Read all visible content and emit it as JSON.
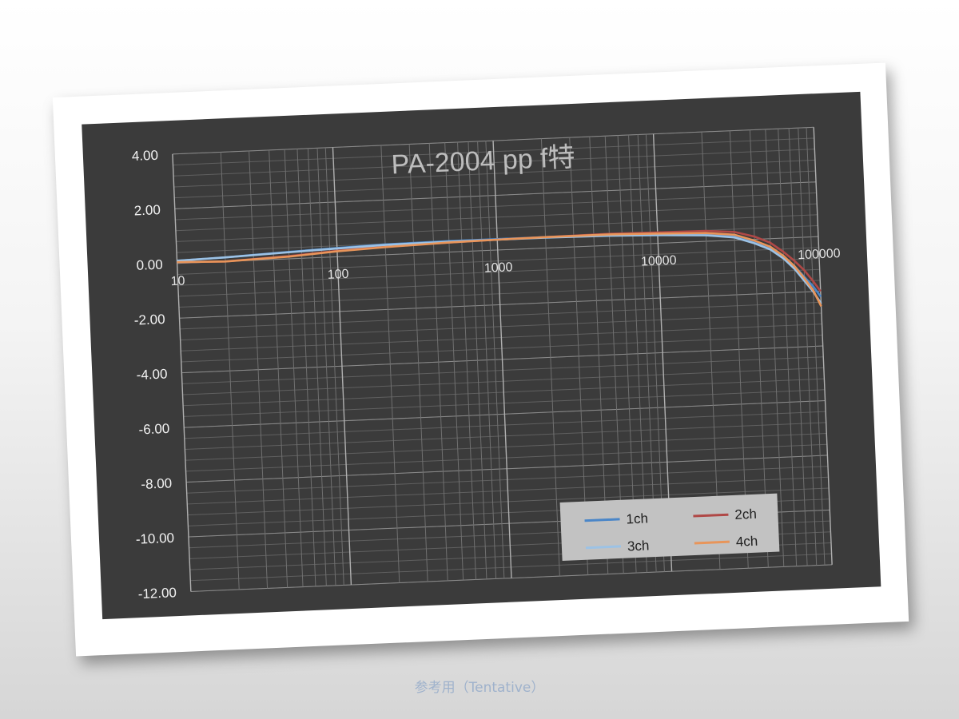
{
  "chart_data": {
    "type": "line",
    "title": "PA-2004 pp f特",
    "xscale": "log",
    "xlim": [
      10,
      100000
    ],
    "ylim": [
      -12,
      4
    ],
    "x_ticks": [
      "10",
      "100",
      "1000",
      "10000",
      "100000"
    ],
    "y_ticks": [
      "4.00",
      "2.00",
      "0.00",
      "-2.00",
      "-4.00",
      "-6.00",
      "-8.00",
      "-10.00",
      "-12.00"
    ],
    "grid": true,
    "legend_position": "bottom-right",
    "series": [
      {
        "name": "1ch",
        "color": "#4a86c8",
        "points": [
          [
            10,
            0.1
          ],
          [
            20,
            0.15
          ],
          [
            50,
            0.25
          ],
          [
            100,
            0.32
          ],
          [
            200,
            0.38
          ],
          [
            500,
            0.4
          ],
          [
            1000,
            0.4
          ],
          [
            2000,
            0.4
          ],
          [
            5000,
            0.38
          ],
          [
            10000,
            0.3
          ],
          [
            20000,
            0.25
          ],
          [
            30000,
            0.15
          ],
          [
            40000,
            -0.1
          ],
          [
            50000,
            -0.35
          ],
          [
            60000,
            -0.7
          ],
          [
            70000,
            -1.05
          ],
          [
            80000,
            -1.45
          ],
          [
            90000,
            -1.8
          ],
          [
            100000,
            -2.2
          ]
        ]
      },
      {
        "name": "2ch",
        "color": "#b04846",
        "points": [
          [
            10,
            0.05
          ],
          [
            20,
            0.0
          ],
          [
            50,
            0.1
          ],
          [
            100,
            0.22
          ],
          [
            200,
            0.3
          ],
          [
            500,
            0.35
          ],
          [
            1000,
            0.38
          ],
          [
            2000,
            0.4
          ],
          [
            5000,
            0.42
          ],
          [
            10000,
            0.4
          ],
          [
            20000,
            0.38
          ],
          [
            30000,
            0.3
          ],
          [
            40000,
            0.1
          ],
          [
            50000,
            -0.15
          ],
          [
            60000,
            -0.5
          ],
          [
            70000,
            -0.85
          ],
          [
            80000,
            -1.2
          ],
          [
            90000,
            -1.6
          ],
          [
            100000,
            -2.0
          ]
        ]
      },
      {
        "name": "3ch",
        "color": "#9cc2e5",
        "points": [
          [
            10,
            0.1
          ],
          [
            20,
            0.15
          ],
          [
            50,
            0.24
          ],
          [
            100,
            0.3
          ],
          [
            200,
            0.36
          ],
          [
            500,
            0.38
          ],
          [
            1000,
            0.38
          ],
          [
            2000,
            0.38
          ],
          [
            5000,
            0.35
          ],
          [
            10000,
            0.3
          ],
          [
            20000,
            0.22
          ],
          [
            30000,
            0.1
          ],
          [
            40000,
            -0.15
          ],
          [
            50000,
            -0.4
          ],
          [
            60000,
            -0.75
          ],
          [
            70000,
            -1.15
          ],
          [
            80000,
            -1.6
          ],
          [
            90000,
            -2.0
          ],
          [
            100000,
            -2.45
          ]
        ]
      },
      {
        "name": "4ch",
        "color": "#e8955a",
        "points": [
          [
            10,
            0.05
          ],
          [
            20,
            0.0
          ],
          [
            50,
            0.08
          ],
          [
            100,
            0.2
          ],
          [
            200,
            0.28
          ],
          [
            500,
            0.35
          ],
          [
            1000,
            0.38
          ],
          [
            2000,
            0.4
          ],
          [
            5000,
            0.4
          ],
          [
            10000,
            0.36
          ],
          [
            20000,
            0.3
          ],
          [
            30000,
            0.2
          ],
          [
            40000,
            -0.05
          ],
          [
            50000,
            -0.3
          ],
          [
            60000,
            -0.65
          ],
          [
            70000,
            -1.05
          ],
          [
            80000,
            -1.5
          ],
          [
            90000,
            -1.95
          ],
          [
            100000,
            -2.55
          ]
        ]
      }
    ]
  },
  "caption": "参考用（Tentative）"
}
